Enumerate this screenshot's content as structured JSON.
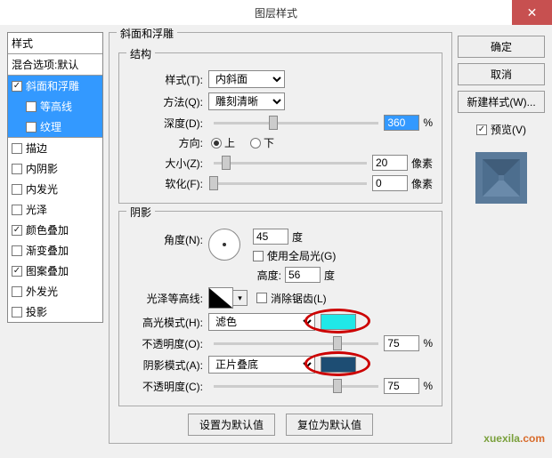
{
  "window": {
    "title": "图层样式"
  },
  "styles_panel": {
    "header": "样式",
    "blend_options": "混合选项:默认",
    "items": [
      {
        "label": "斜面和浮雕",
        "checked": true,
        "selected": true
      },
      {
        "label": "等高线",
        "checked": false,
        "child": true,
        "selected": true
      },
      {
        "label": "纹理",
        "checked": false,
        "child": true,
        "selected": true
      },
      {
        "label": "描边",
        "checked": false
      },
      {
        "label": "内阴影",
        "checked": false
      },
      {
        "label": "内发光",
        "checked": false
      },
      {
        "label": "光泽",
        "checked": false
      },
      {
        "label": "颜色叠加",
        "checked": true
      },
      {
        "label": "渐变叠加",
        "checked": false
      },
      {
        "label": "图案叠加",
        "checked": true
      },
      {
        "label": "外发光",
        "checked": false
      },
      {
        "label": "投影",
        "checked": false
      }
    ]
  },
  "bevel": {
    "group_title": "斜面和浮雕",
    "structure": {
      "title": "结构",
      "style_label": "样式(T):",
      "style_value": "内斜面",
      "technique_label": "方法(Q):",
      "technique_value": "雕刻清晰",
      "depth_label": "深度(D):",
      "depth_value": "360",
      "depth_unit": "%",
      "direction_label": "方向:",
      "up": "上",
      "down": "下",
      "size_label": "大小(Z):",
      "size_value": "20",
      "size_unit": "像素",
      "soften_label": "软化(F):",
      "soften_value": "0",
      "soften_unit": "像素"
    },
    "shading": {
      "title": "阴影",
      "angle_label": "角度(N):",
      "angle_value": "45",
      "angle_unit": "度",
      "global_light_label": "使用全局光(G)",
      "altitude_label": "高度:",
      "altitude_value": "56",
      "altitude_unit": "度",
      "gloss_label": "光泽等高线:",
      "antialias_label": "消除锯齿(L)",
      "highlight_mode_label": "高光模式(H):",
      "highlight_mode_value": "滤色",
      "highlight_color": "#20e8e8",
      "highlight_opacity_label": "不透明度(O):",
      "highlight_opacity_value": "75",
      "opacity_unit": "%",
      "shadow_mode_label": "阴影模式(A):",
      "shadow_mode_value": "正片叠底",
      "shadow_color": "#1d4d73",
      "shadow_opacity_label": "不透明度(C):",
      "shadow_opacity_value": "75"
    },
    "buttons": {
      "make_default": "设置为默认值",
      "reset_default": "复位为默认值"
    }
  },
  "right": {
    "ok": "确定",
    "cancel": "取消",
    "new_style": "新建样式(W)...",
    "preview_label": "预览(V)"
  },
  "watermark": {
    "a": "xuexila",
    "b": ".com"
  }
}
